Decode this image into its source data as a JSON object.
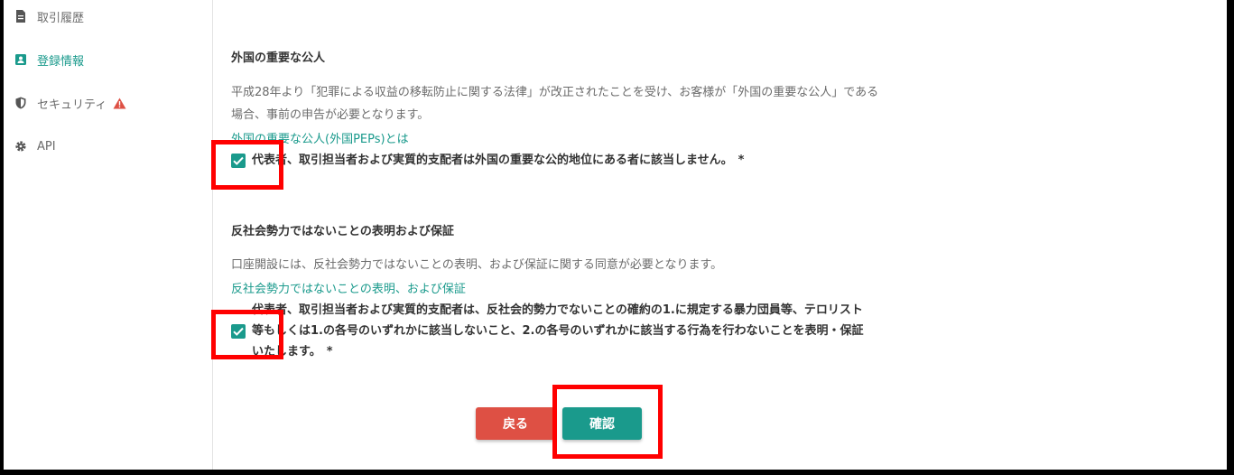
{
  "sidebar": {
    "items": [
      {
        "label": "取引履歴",
        "icon": "document-icon"
      },
      {
        "label": "登録情報",
        "icon": "id-badge-icon",
        "active": true
      },
      {
        "label": "セキュリティ",
        "icon": "shield-icon",
        "warning": true
      },
      {
        "label": "API",
        "icon": "gear-icon"
      }
    ]
  },
  "pep": {
    "title": "外国の重要な公人",
    "description": "平成28年より「犯罪による収益の移転防止に関する法律」が改正されたことを受け、お客様が「外国の重要な公人」である場合、事前の申告が必要となります。",
    "link": "外国の重要な公人(外国PEPs)とは",
    "checkbox_label": "代表者、取引担当者および実質的支配者は外国の重要な公的地位にある者に該当しません。",
    "checked": true,
    "required_mark": "*"
  },
  "antisocial": {
    "title": "反社会勢力ではないことの表明および保証",
    "description": "口座開設には、反社会勢力ではないことの表明、および保証に関する同意が必要となります。",
    "link": "反社会勢力ではないことの表明、および保証",
    "checkbox_label": "代表者、取引担当者および実質的支配者は、反社会的勢力でないことの確約の1.に規定する暴力団員等、テロリスト等もしくは1.の各号のいずれかに該当しないこと、2.の各号のいずれかに該当する行為を行わないことを表明・保証いたします。",
    "checked": true,
    "required_mark": "*"
  },
  "buttons": {
    "back": "戻る",
    "confirm": "確認"
  },
  "colors": {
    "accent": "#1a9a8c",
    "danger": "#de5044",
    "highlight": "#ff0000"
  }
}
